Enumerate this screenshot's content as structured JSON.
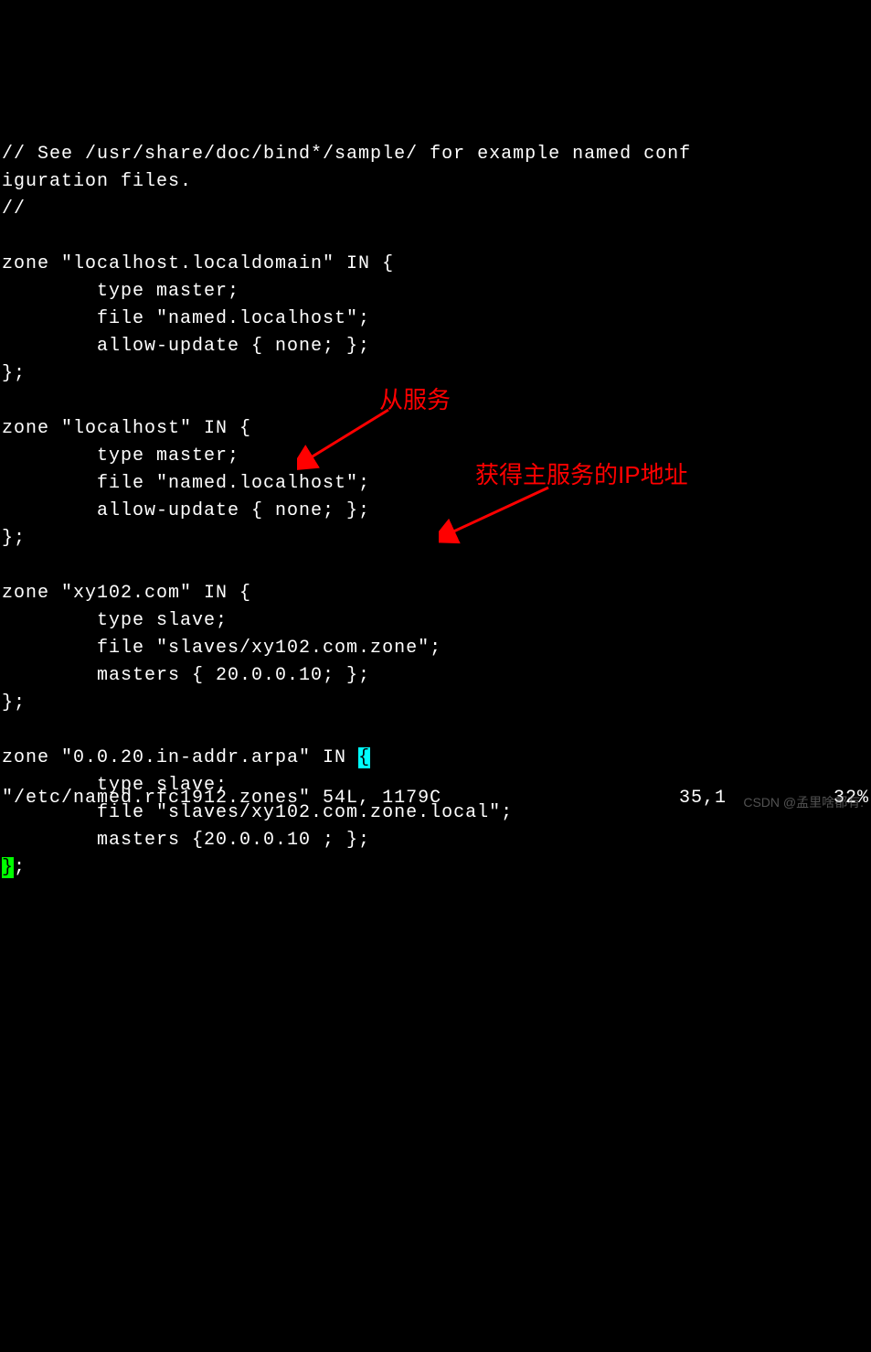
{
  "lines": {
    "l0": "// See /usr/share/doc/bind*/sample/ for example named conf",
    "l1": "iguration files.",
    "l2": "//",
    "l3": "",
    "l4": "zone \"localhost.localdomain\" IN {",
    "l5": "        type master;",
    "l6": "        file \"named.localhost\";",
    "l7": "        allow-update { none; };",
    "l8": "};",
    "l9": "",
    "l10": "zone \"localhost\" IN {",
    "l11": "        type master;",
    "l12": "        file \"named.localhost\";",
    "l13": "        allow-update { none; };",
    "l14": "};",
    "l15": "",
    "l16": "zone \"xy102.com\" IN {",
    "l17": "        type slave;",
    "l18a": "        file \"slaves/xy102.com.zone",
    "l18b": "\"",
    "l18c": ";",
    "l19": "        masters { 20.0.0.10; };",
    "l20": "};",
    "l21": "",
    "l22a": "zone \"0.0.20.in-addr.arpa\" IN ",
    "l22b": "{",
    "l23": "        type slave;",
    "l24": "        file \"slaves/xy102.com.zone.local\";",
    "l25": "        masters {20.0.0.10 ; };",
    "l26a": "}",
    "l26b": ";"
  },
  "annotations": {
    "a1": "从服务",
    "a2": "获得主服务的IP地址"
  },
  "status": {
    "file": "\"/etc/named.rfc1912.zones\" 54L, 1179C",
    "pos": "35,1",
    "pct": "32%"
  },
  "watermark": "CSDN @孟里啥都有."
}
